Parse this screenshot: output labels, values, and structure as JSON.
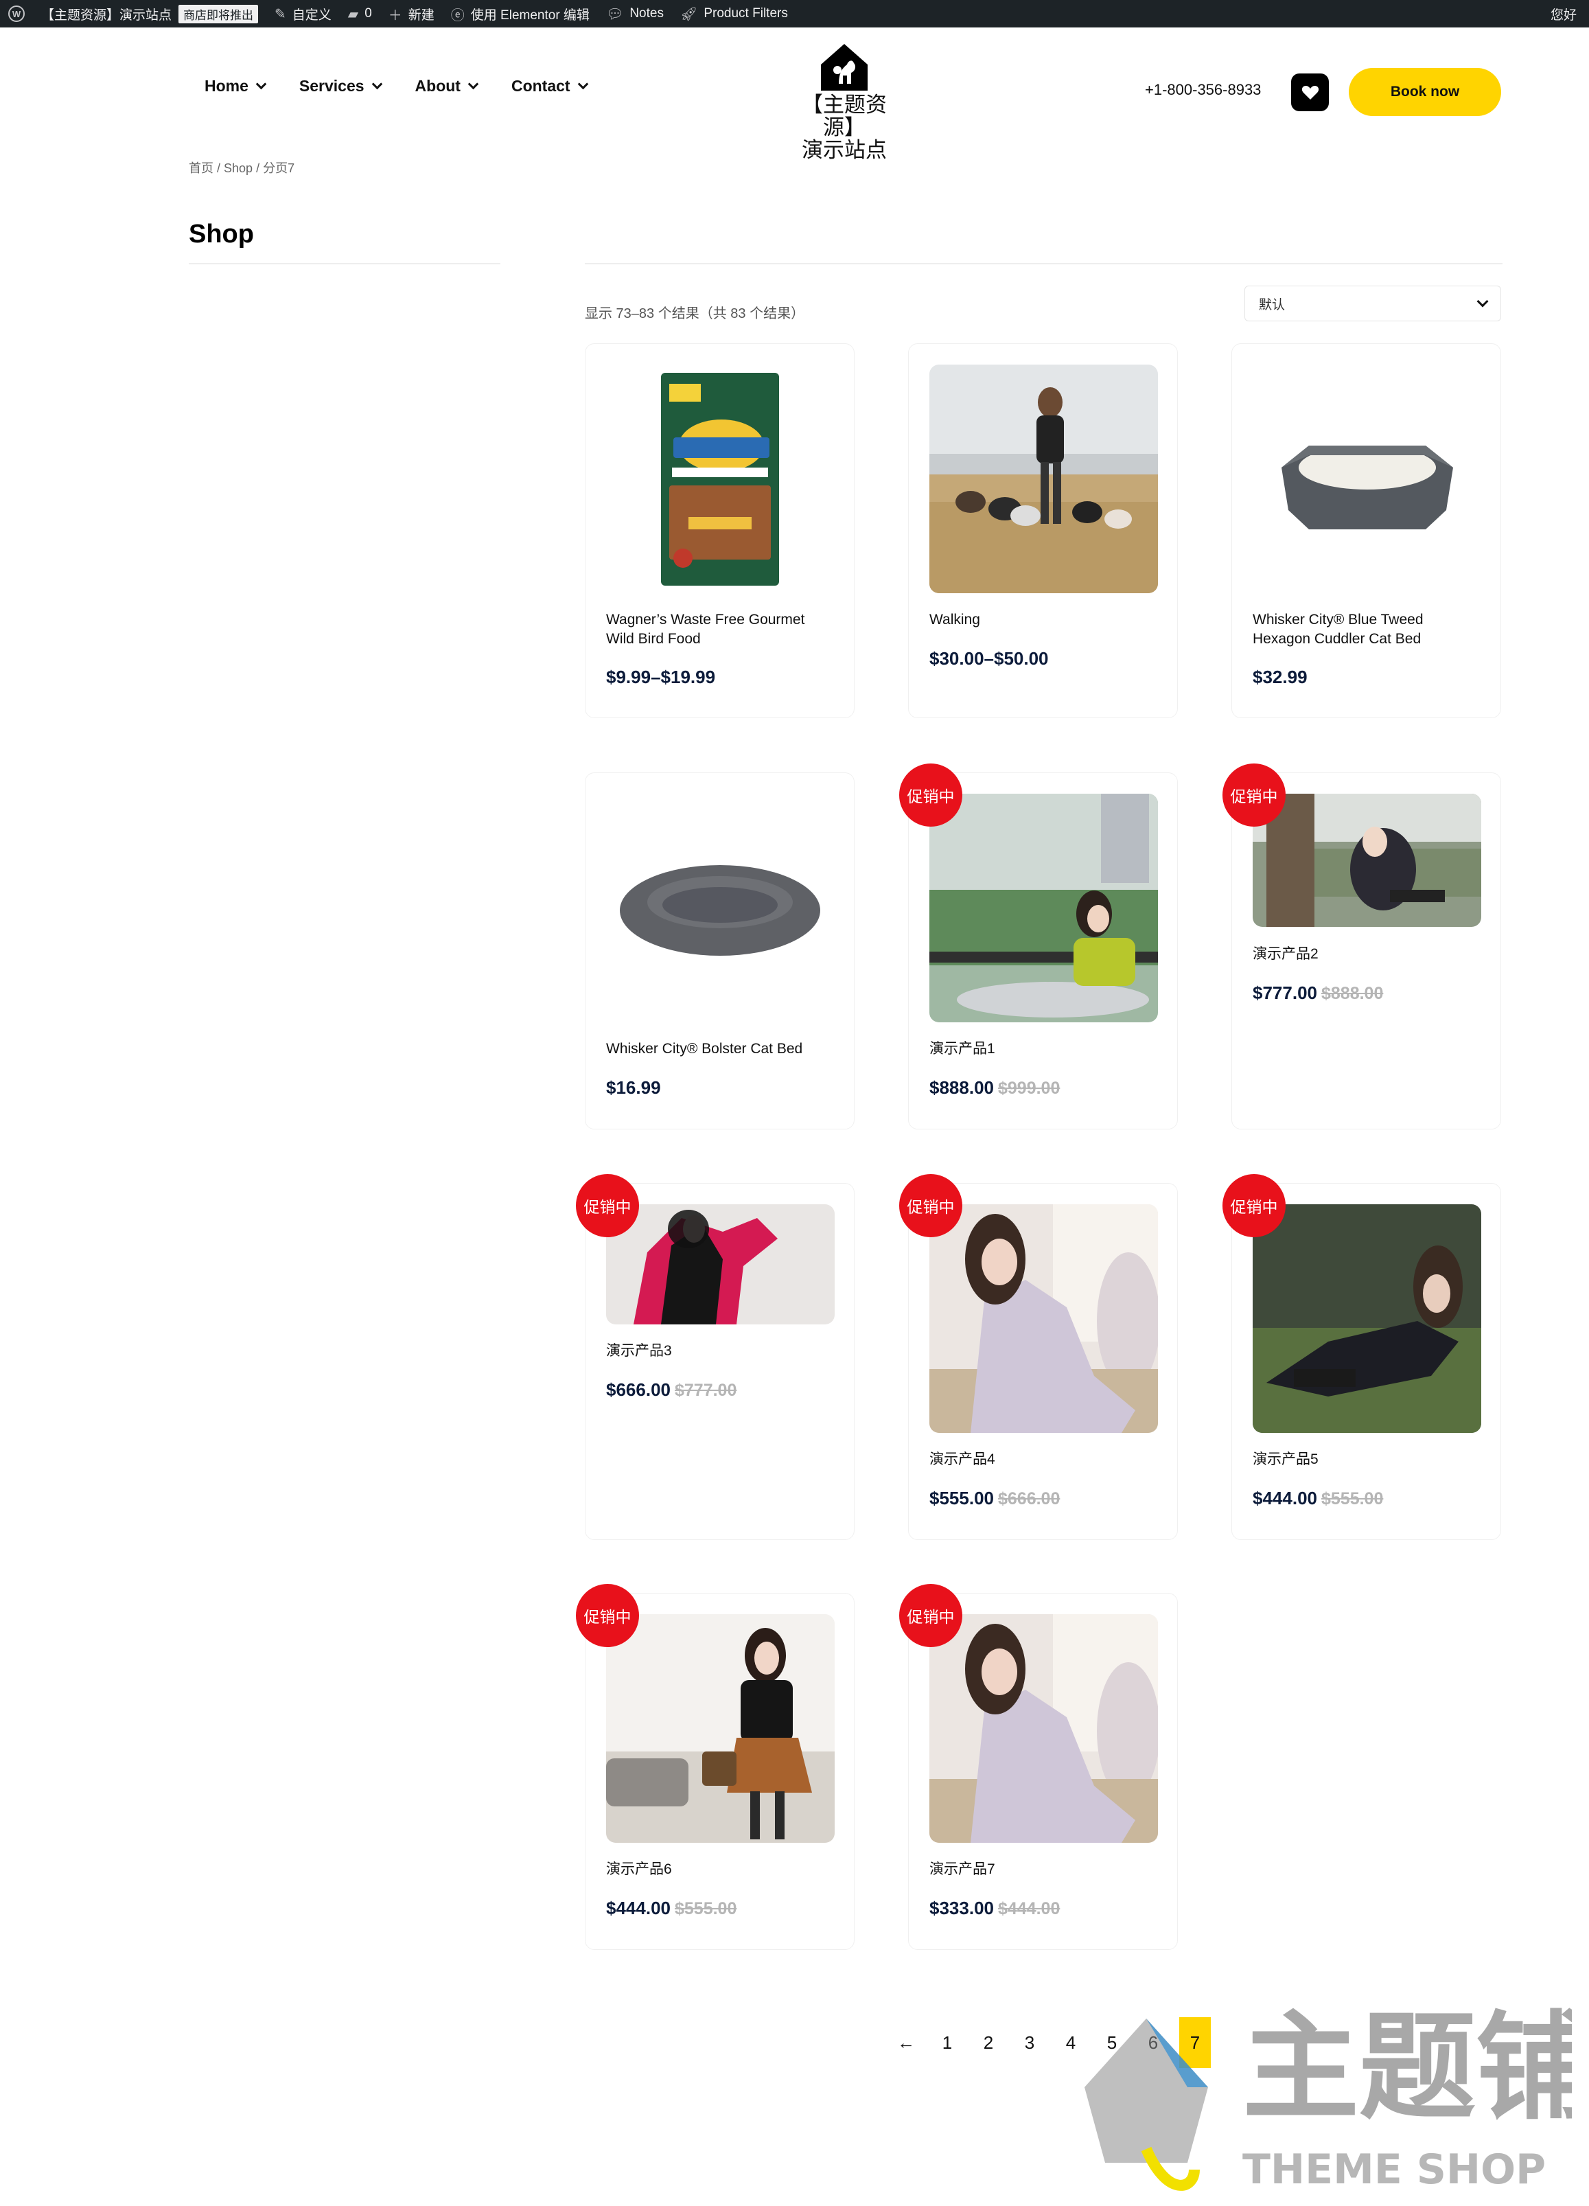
{
  "admin_bar": {
    "site_name": "【主题资源】演示站点",
    "store_badge": "商店即将推出",
    "customize": "自定义",
    "comments_count": "0",
    "new": "新建",
    "elementor": "使用 Elementor 编辑",
    "notes": "Notes",
    "product_filters": "Product Filters",
    "greeting": "您好"
  },
  "header": {
    "nav": [
      "Home",
      "Services",
      "About",
      "Contact"
    ],
    "logo_line1": "【主题资源】",
    "logo_line2": "演示站点",
    "phone": "+1-800-356-8933",
    "book_label": "Book now"
  },
  "breadcrumb": {
    "home": "首页",
    "shop": "Shop",
    "current": "分页7",
    "sep": " / "
  },
  "page_title": "Shop",
  "result_count": "显示 73–83 个结果（共 83 个结果）",
  "sort_selected": "默认",
  "sale_badge": "促销中",
  "products": [
    {
      "name": "Wagner’s Waste Free Gourmet Wild Bird Food",
      "price": "$9.99–$19.99",
      "old_price": ""
    },
    {
      "name": "Walking",
      "price": "$30.00–$50.00",
      "old_price": ""
    },
    {
      "name": "Whisker City® Blue Tweed Hexagon Cuddler Cat Bed",
      "price": "$32.99",
      "old_price": ""
    },
    {
      "name": "Whisker City® Bolster Cat Bed",
      "price": "$16.99",
      "old_price": ""
    },
    {
      "name": "演示产品1",
      "price": "$888.00",
      "old_price": "$999.00"
    },
    {
      "name": "演示产品2",
      "price": "$777.00",
      "old_price": "$888.00"
    },
    {
      "name": "演示产品3",
      "price": "$666.00",
      "old_price": "$777.00"
    },
    {
      "name": "演示产品4",
      "price": "$555.00",
      "old_price": "$666.00"
    },
    {
      "name": "演示产品5",
      "price": "$444.00",
      "old_price": "$555.00"
    },
    {
      "name": "演示产品6",
      "price": "$444.00",
      "old_price": "$555.00"
    },
    {
      "name": "演示产品7",
      "price": "$333.00",
      "old_price": "$444.00"
    }
  ],
  "pagination": {
    "prev": "←",
    "pages": [
      "1",
      "2",
      "3",
      "4",
      "5",
      "6",
      "7"
    ],
    "current": "7"
  },
  "watermark": {
    "text_cn": "主题铺",
    "text_en": "THEME SHOP"
  },
  "colors": {
    "accent": "#ffd400",
    "sale": "#e8111b",
    "price": "#0c1b3a",
    "admin_bar": "#1d2327"
  }
}
